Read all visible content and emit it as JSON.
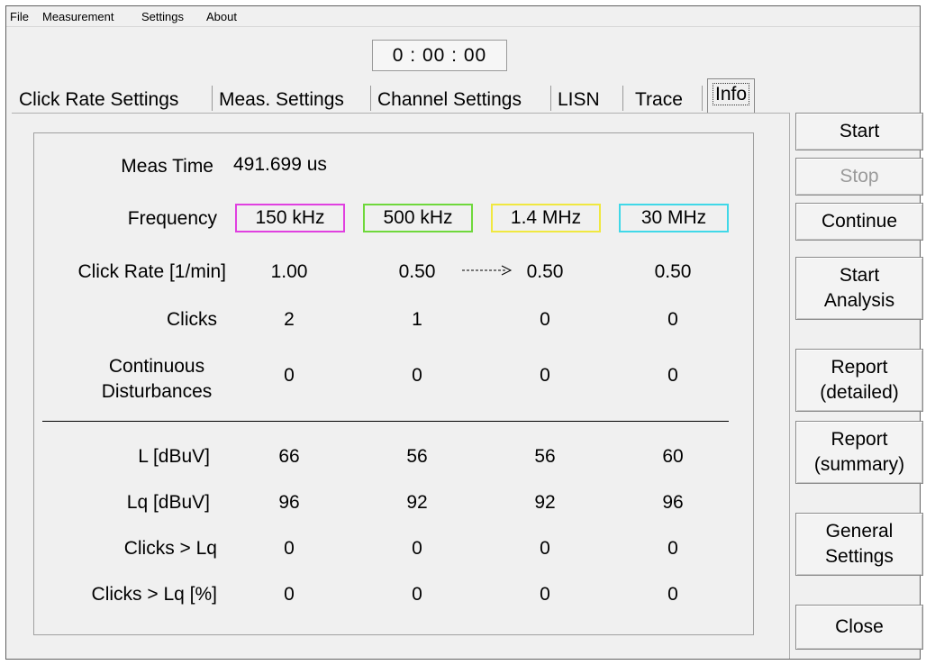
{
  "menu": {
    "file": "File",
    "measurement": "Measurement",
    "settings": "Settings",
    "about": "About"
  },
  "timer": "0 : 00 : 00",
  "tabs": [
    {
      "label": "Click Rate Settings"
    },
    {
      "label": "Meas. Settings"
    },
    {
      "label": "Channel Settings"
    },
    {
      "label": "LISN"
    },
    {
      "label": "Trace"
    },
    {
      "label": "Info",
      "active": true
    }
  ],
  "info": {
    "meas_time_label": "Meas Time",
    "meas_time_value": "491.699 us",
    "labels": {
      "frequency": "Frequency",
      "click_rate": "Click Rate [1/min]",
      "clicks": "Clicks",
      "continuous_1": "Continuous",
      "continuous_2": "Disturbances",
      "l": "L [dBuV]",
      "lq": "Lq [dBuV]",
      "clicks_gt_lq": "Clicks > Lq",
      "clicks_gt_lq_pct": "Clicks > Lq [%]"
    },
    "channels": [
      {
        "frequency": "150 kHz",
        "color": "#e040e0",
        "click_rate": "1.00",
        "clicks": "2",
        "continuous": "0",
        "l": "66",
        "lq": "96",
        "clicks_gt_lq": "0",
        "clicks_gt_lq_pct": "0"
      },
      {
        "frequency": "500 kHz",
        "color": "#6fd83c",
        "click_rate": "0.50",
        "clicks": "1",
        "continuous": "0",
        "l": "56",
        "lq": "92",
        "clicks_gt_lq": "0",
        "clicks_gt_lq_pct": "0"
      },
      {
        "frequency": "1.4 MHz",
        "color": "#f0e840",
        "click_rate": "0.50",
        "clicks": "0",
        "continuous": "0",
        "l": "56",
        "lq": "92",
        "clicks_gt_lq": "0",
        "clicks_gt_lq_pct": "0"
      },
      {
        "frequency": "30 MHz",
        "color": "#40d8e8",
        "click_rate": "0.50",
        "clicks": "0",
        "continuous": "0",
        "l": "60",
        "lq": "96",
        "clicks_gt_lq": "0",
        "clicks_gt_lq_pct": "0"
      }
    ]
  },
  "buttons": {
    "start": "Start",
    "stop": "Stop",
    "continue": "Continue",
    "start_analysis_1": "Start",
    "start_analysis_2": "Analysis",
    "report_detailed_1": "Report",
    "report_detailed_2": "(detailed)",
    "report_summary_1": "Report",
    "report_summary_2": "(summary)",
    "general_settings_1": "General",
    "general_settings_2": "Settings",
    "close": "Close"
  }
}
